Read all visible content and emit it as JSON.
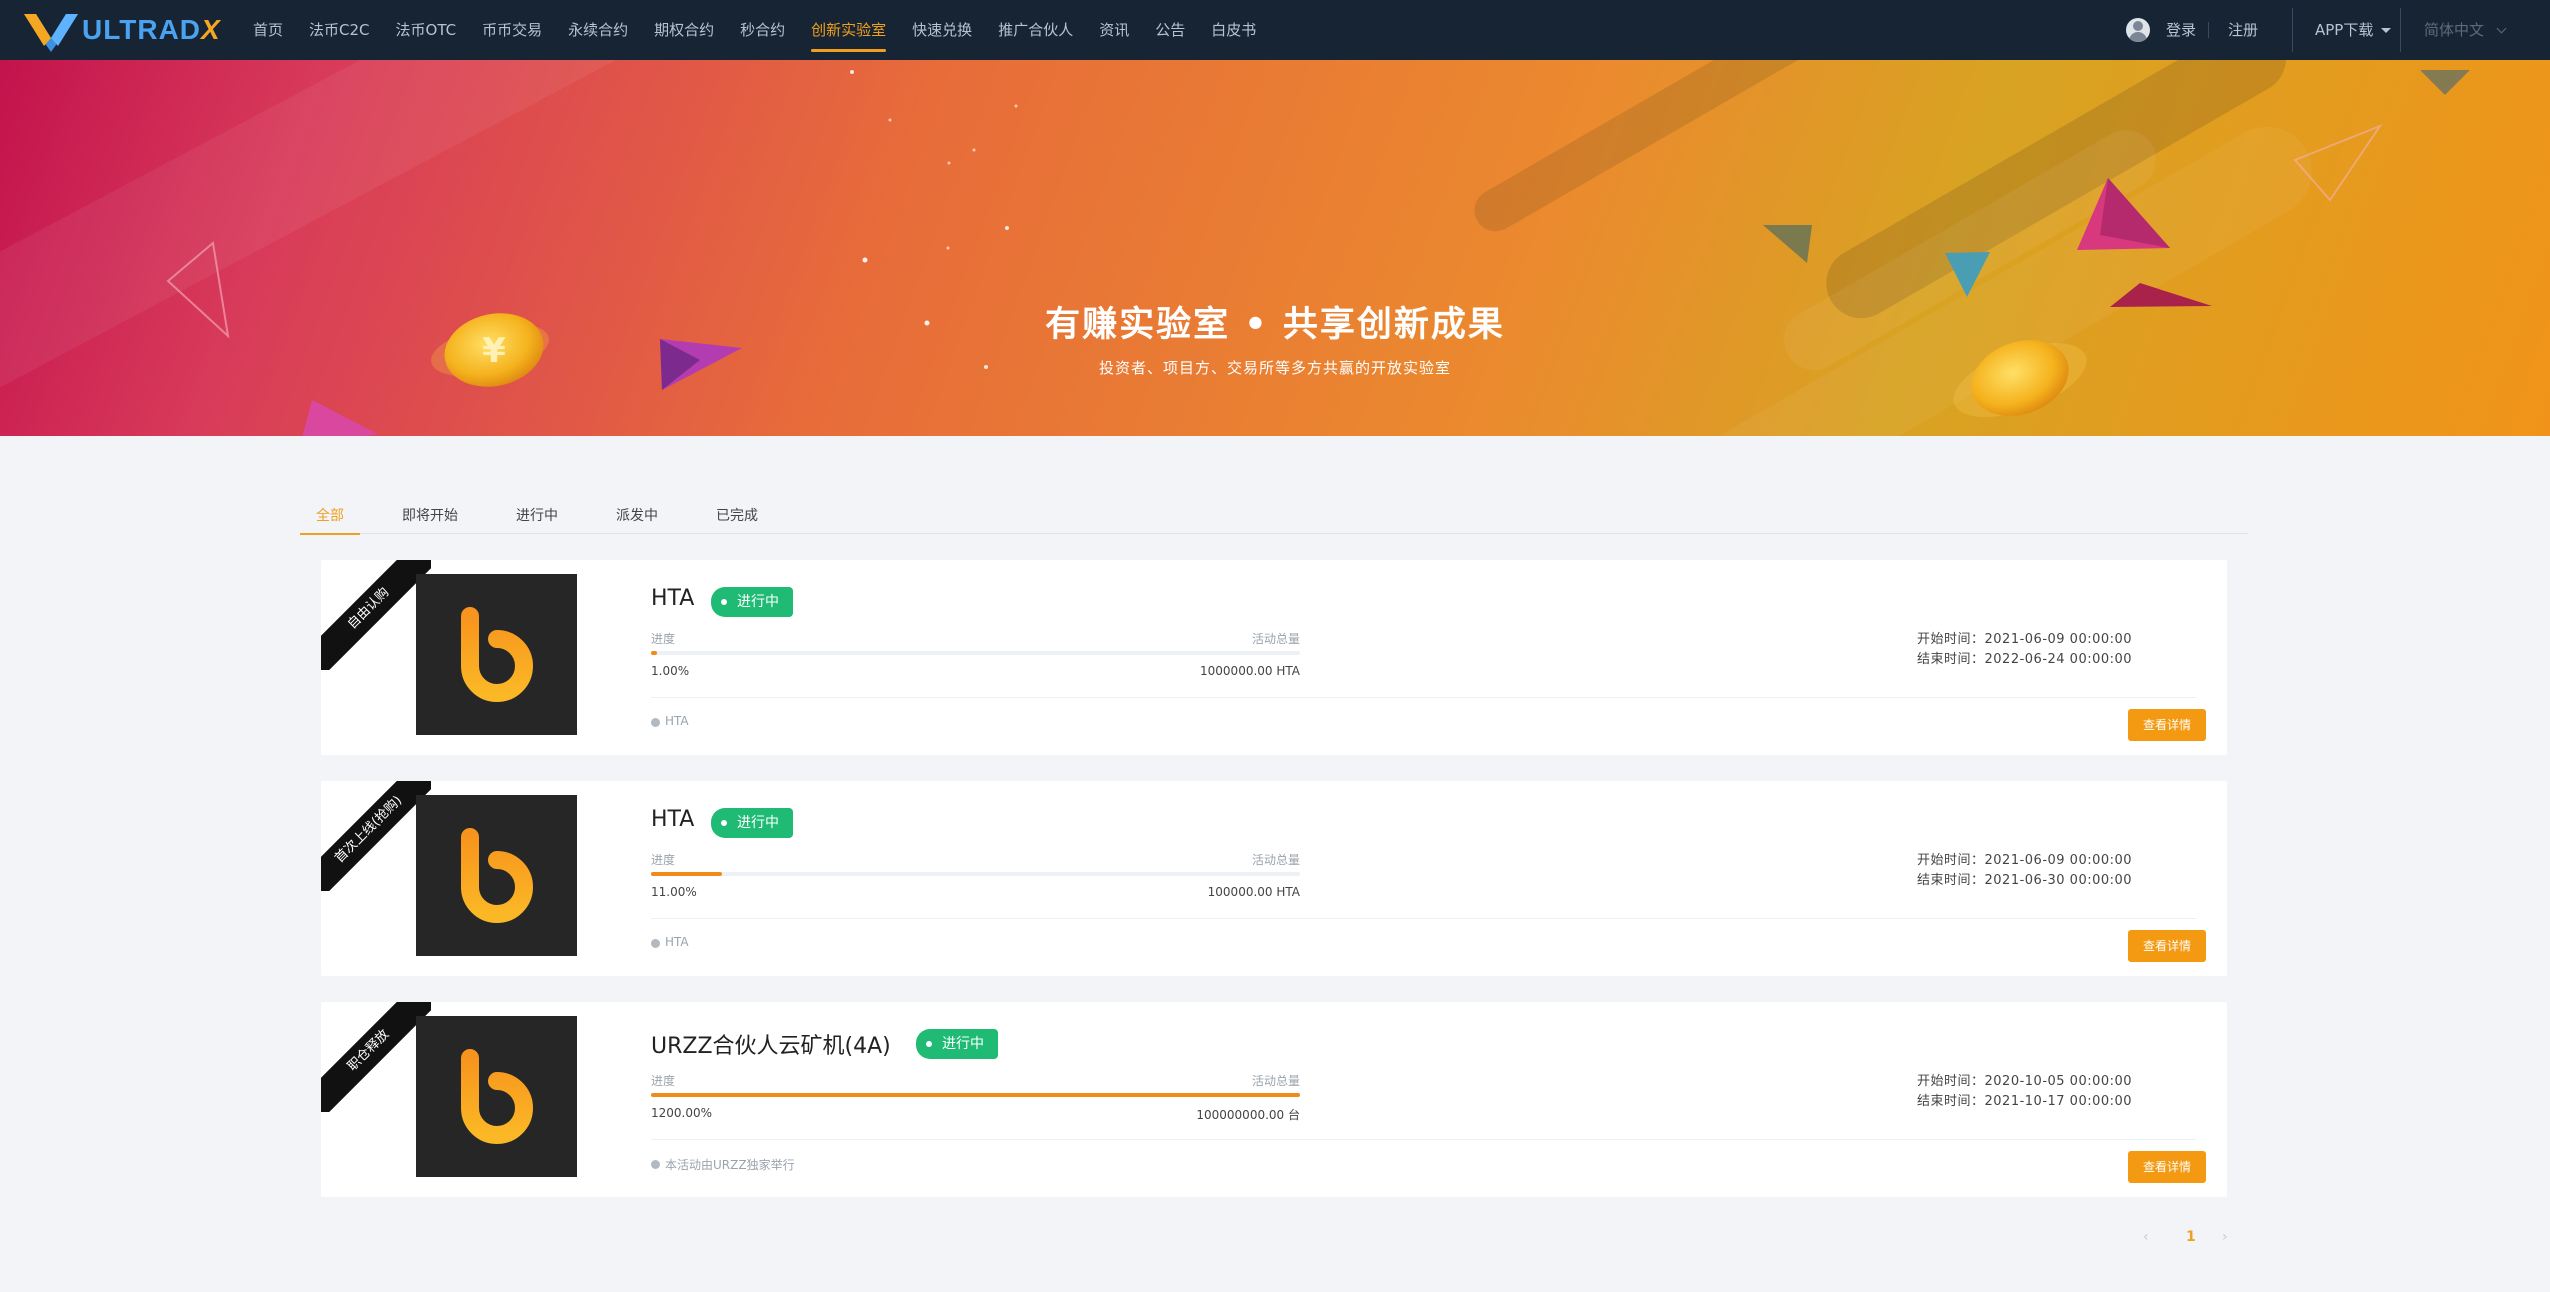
{
  "nav": {
    "logo_text": "ULTRAD",
    "logo_x": "X",
    "items": [
      {
        "label": "首页"
      },
      {
        "label": "法币C2C"
      },
      {
        "label": "法币OTC"
      },
      {
        "label": "币币交易"
      },
      {
        "label": "永续合约"
      },
      {
        "label": "期权合约"
      },
      {
        "label": "秒合约"
      },
      {
        "label": "创新实验室",
        "active": true
      },
      {
        "label": "快速兑换"
      },
      {
        "label": "推广合伙人"
      },
      {
        "label": "资讯"
      },
      {
        "label": "公告"
      },
      {
        "label": "白皮书"
      }
    ],
    "login": "登录",
    "register": "注册",
    "app_download": "APP下载",
    "language": "简体中文"
  },
  "banner": {
    "title": "有赚实验室 • 共享创新成果",
    "subtitle": "投资者、项目方、交易所等多方共赢的开放实验室"
  },
  "tabs": [
    {
      "label": "全部",
      "active": true
    },
    {
      "label": "即将开始"
    },
    {
      "label": "进行中"
    },
    {
      "label": "派发中"
    },
    {
      "label": "已完成"
    }
  ],
  "labels": {
    "progress": "进度",
    "total": "活动总量",
    "detail_button": "查看详情"
  },
  "projects": [
    {
      "ribbon": "自由认购",
      "name": "HTA",
      "status": "进行中",
      "progress_text": "1.00%",
      "progress_fraction": 0.01,
      "total": "1000000.00 HTA",
      "start": "开始时间：2021-06-09 00:00:00",
      "end": "结束时间：2022-06-24 00:00:00",
      "footer": "HTA"
    },
    {
      "ribbon": "首次上线(抢购)",
      "name": "HTA",
      "status": "进行中",
      "progress_text": "11.00%",
      "progress_fraction": 0.11,
      "total": "100000.00 HTA",
      "start": "开始时间：2021-06-09 00:00:00",
      "end": "结束时间：2021-06-30 00:00:00",
      "footer": "HTA"
    },
    {
      "ribbon": "职仓释放",
      "name": "URZZ合伙人云矿机(4A)",
      "status": "进行中",
      "progress_text": "1200.00%",
      "progress_fraction": 1.0,
      "total": "100000000.00 台",
      "start": "开始时间：2020-10-05 00:00:00",
      "end": "结束时间：2021-10-17 00:00:00",
      "footer": "本活动由URZZ独家举行"
    }
  ],
  "pagination": {
    "prev": "‹",
    "current": "1",
    "next": "›"
  },
  "icons": {
    "user": "user-avatar-icon",
    "caret": "caret-down-icon",
    "chevron": "chevron-down-icon",
    "coin": "yen-coin-icon"
  },
  "colors": {
    "nav_bg": "#172433",
    "accent": "#f0a01e",
    "status_green": "#1fbb74",
    "button_orange": "#f39a12",
    "progress_orange": "#f28a1a"
  }
}
